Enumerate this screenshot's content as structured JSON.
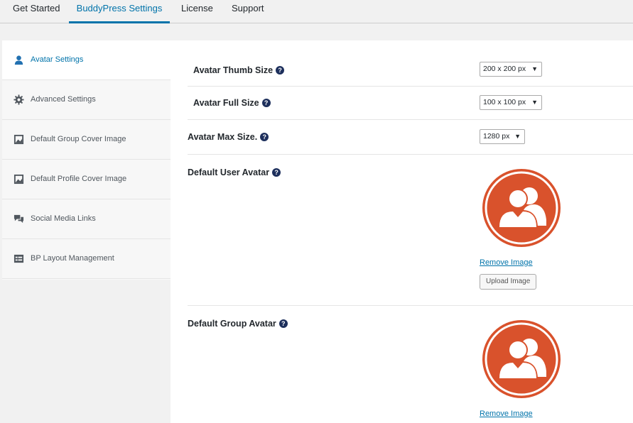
{
  "tabs": [
    {
      "label": "Get Started"
    },
    {
      "label": "BuddyPress Settings"
    },
    {
      "label": "License"
    },
    {
      "label": "Support"
    }
  ],
  "sidebar": {
    "items": [
      {
        "label": "Avatar Settings",
        "icon": "user-icon"
      },
      {
        "label": "Advanced Settings",
        "icon": "gear-icon"
      },
      {
        "label": "Default Group Cover Image",
        "icon": "image-icon"
      },
      {
        "label": "Default Profile Cover Image",
        "icon": "image-icon"
      },
      {
        "label": "Social Media Links",
        "icon": "chat-icon"
      },
      {
        "label": "BP Layout Management",
        "icon": "layout-icon"
      }
    ]
  },
  "settings": {
    "thumb_size": {
      "label": "Avatar Thumb Size",
      "value": "200 x 200 px"
    },
    "full_size": {
      "label": "Avatar Full Size",
      "value": "100 x 100 px"
    },
    "max_size": {
      "label": "Avatar Max Size.",
      "value": "1280 px"
    },
    "user_avatar": {
      "label": "Default User Avatar",
      "remove_label": "Remove Image",
      "upload_label": "Upload Image"
    },
    "group_avatar": {
      "label": "Default Group Avatar",
      "remove_label": "Remove Image"
    }
  },
  "help_glyph": "?",
  "caret_glyph": "▼",
  "colors": {
    "accent": "#0073aa",
    "avatar": "#d9522c",
    "help": "#1d2f5c"
  }
}
